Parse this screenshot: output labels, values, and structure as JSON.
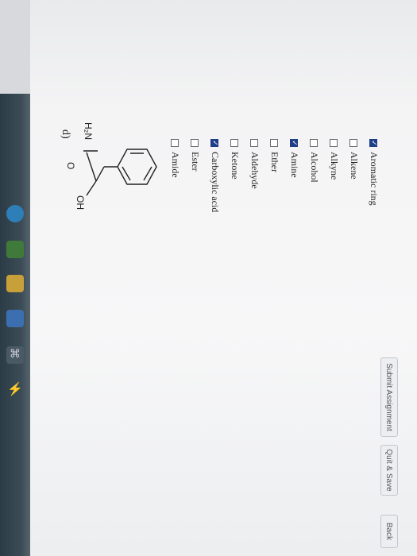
{
  "question": {
    "label": "d)"
  },
  "molecule": {
    "amine_label": "H₂N",
    "hydroxyl_label": "OH",
    "carbonyl_label": "O"
  },
  "options": [
    {
      "label": "Aromatic ring",
      "checked": true
    },
    {
      "label": "Alkene",
      "checked": false
    },
    {
      "label": "Alkyne",
      "checked": false
    },
    {
      "label": "Alcohol",
      "checked": false
    },
    {
      "label": "Amine",
      "checked": true
    },
    {
      "label": "Ether",
      "checked": false
    },
    {
      "label": "Aldehyde",
      "checked": false
    },
    {
      "label": "Ketone",
      "checked": false
    },
    {
      "label": "Carboxylic acid",
      "checked": true
    },
    {
      "label": "Ester",
      "checked": false
    },
    {
      "label": "Amide",
      "checked": false
    }
  ],
  "buttons": {
    "submit": "Submit Assignment",
    "quit": "Quit & Save",
    "back": "Back"
  },
  "colors": {
    "checkbox_checked": "#1e3f88",
    "taskbar": "#2c3c46"
  }
}
